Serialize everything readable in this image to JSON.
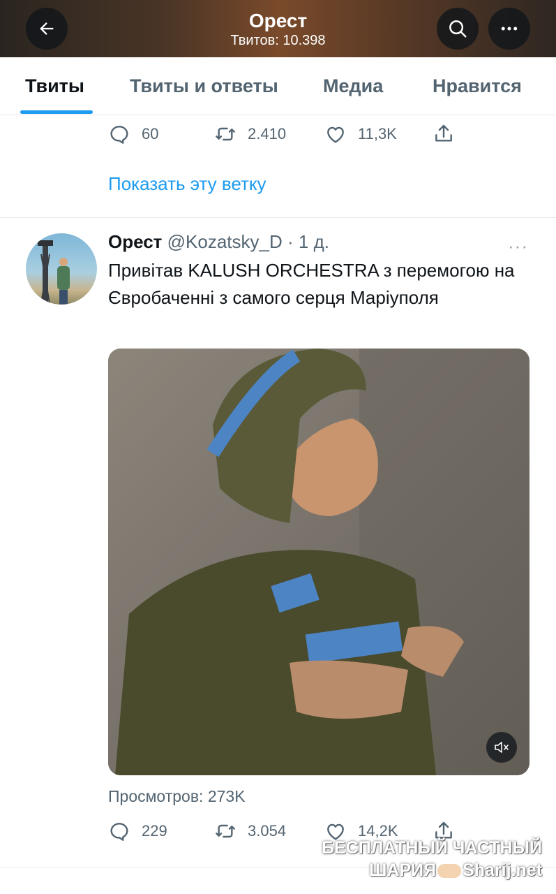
{
  "header": {
    "title": "Орест",
    "subtitle": "Твитов: 10.398"
  },
  "tabs": [
    {
      "label": "Твиты",
      "active": true
    },
    {
      "label": "Твиты и ответы",
      "active": false
    },
    {
      "label": "Медиа",
      "active": false
    },
    {
      "label": "Нравится",
      "active": false
    }
  ],
  "prev_tweet": {
    "replies": "60",
    "retweets": "2.410",
    "likes": "11,3K",
    "show_thread": "Показать эту ветку"
  },
  "tweet": {
    "name": "Орест",
    "handle": "@Kozatsky_D",
    "separator": "·",
    "time": "1 д.",
    "more": "···",
    "text": "Привітав KALUSH ORCHESTRA з перемогою на Євробаченні з самого серця Маріуполя",
    "views": "Просмотров: 273K",
    "replies": "229",
    "retweets": "3.054",
    "likes": "14,2K"
  },
  "watermark": {
    "line1": "БЕСПЛАТНЫЙ ЧАСТНЫЙ",
    "line2a": "ШАРИЯ",
    "line2b": "Sharij.net"
  },
  "colors": {
    "accent": "#1d9bf0",
    "text": "#0f1419",
    "secondary": "#536471"
  },
  "icons": [
    "back-arrow-icon",
    "search-icon",
    "more-icon",
    "reply-icon",
    "retweet-icon",
    "like-icon",
    "share-icon",
    "mute-icon"
  ]
}
